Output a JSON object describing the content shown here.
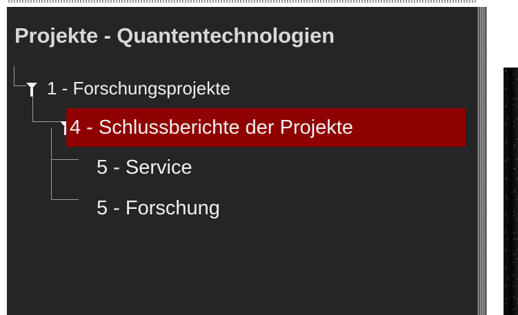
{
  "sidebar": {
    "title": "Projekte - Quantentechnologien",
    "tree": {
      "root": {
        "label": "1 - Forschungsprojekte"
      },
      "selected_child": {
        "label": "4 - Schlussberichte der Projekte"
      },
      "children": [
        {
          "label": "5 - Service"
        },
        {
          "label": "5 - Forschung"
        }
      ]
    }
  },
  "colors": {
    "panel_background": "#252525",
    "selected_background": "#8f0000",
    "primary_text": "#f0f0f0",
    "title_text": "#d8d8d8",
    "tree_line": "#9f9f9f"
  },
  "icons": {
    "expanded": "triangle-down-icon",
    "splitter": "grip-dots-icon"
  }
}
